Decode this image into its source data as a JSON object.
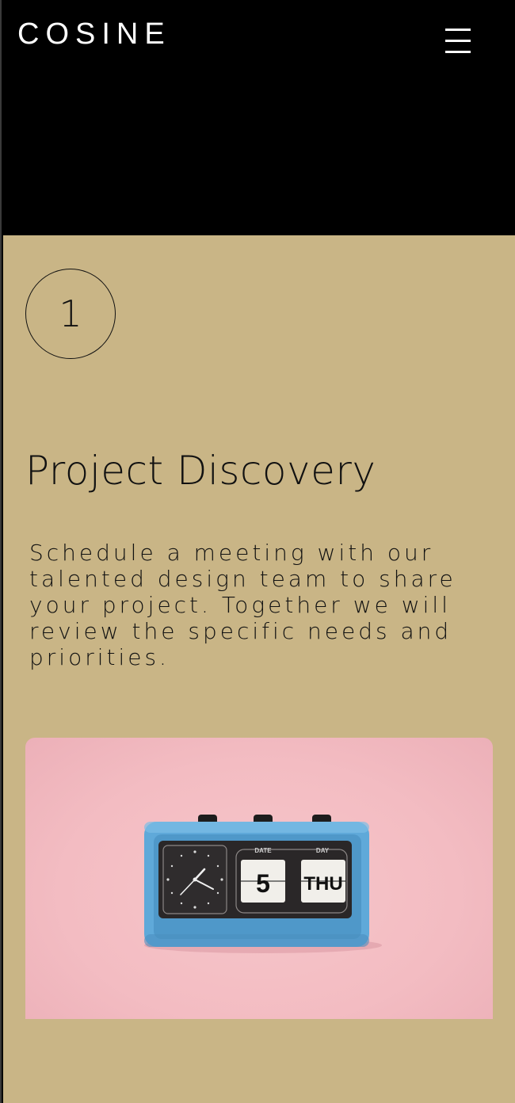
{
  "header": {
    "logo": "COSINE",
    "menu_icon": "hamburger-menu-icon"
  },
  "step": {
    "number": "1",
    "title": "Project Discovery",
    "description": "Schedule a meeting with our talented design team to share your project. Together we will review the specific needs and priorities."
  },
  "image": {
    "clock_labels": {
      "date_header": "DATE",
      "day_header": "DAY",
      "date_value": "5",
      "day_value": "THU"
    }
  },
  "colors": {
    "header_bg": "#000000",
    "section_bg": "#c9b586",
    "photo_bg": "#f4c0c6",
    "clock_body": "#5fa9d9"
  }
}
